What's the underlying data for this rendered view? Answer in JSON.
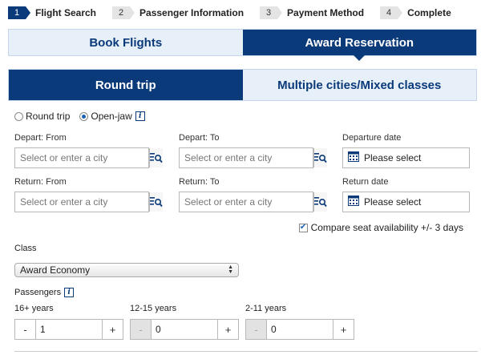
{
  "steps": [
    {
      "num": "1",
      "label": "Flight Search"
    },
    {
      "num": "2",
      "label": "Passenger Information"
    },
    {
      "num": "3",
      "label": "Payment Method"
    },
    {
      "num": "4",
      "label": "Complete"
    }
  ],
  "top_tabs": [
    "Book Flights",
    "Award Reservation"
  ],
  "trip_tabs": [
    "Round trip",
    "Multiple cities/Mixed classes"
  ],
  "trip_options": {
    "round_trip": "Round trip",
    "open_jaw": "Open-jaw",
    "info": "i"
  },
  "depart": {
    "from_label": "Depart: From",
    "to_label": "Depart: To",
    "date_label": "Departure date"
  },
  "return": {
    "from_label": "Return: From",
    "to_label": "Return: To",
    "date_label": "Return date"
  },
  "city_placeholder": "Select or enter a city",
  "date_placeholder": "Please select",
  "compare_label": "Compare seat availability +/- 3 days",
  "class_section": {
    "label": "Class",
    "value": "Award Economy"
  },
  "passengers": {
    "label": "Passengers",
    "info": "i",
    "groups": [
      {
        "label": "16+ years",
        "value": "1"
      },
      {
        "label": "12-15 years",
        "value": "0"
      },
      {
        "label": "2-11 years",
        "value": "0"
      }
    ],
    "minus": "-",
    "plus": "+"
  },
  "colors": {
    "brand": "#0a3a7a",
    "tab_inactive": "#e7eff8"
  }
}
